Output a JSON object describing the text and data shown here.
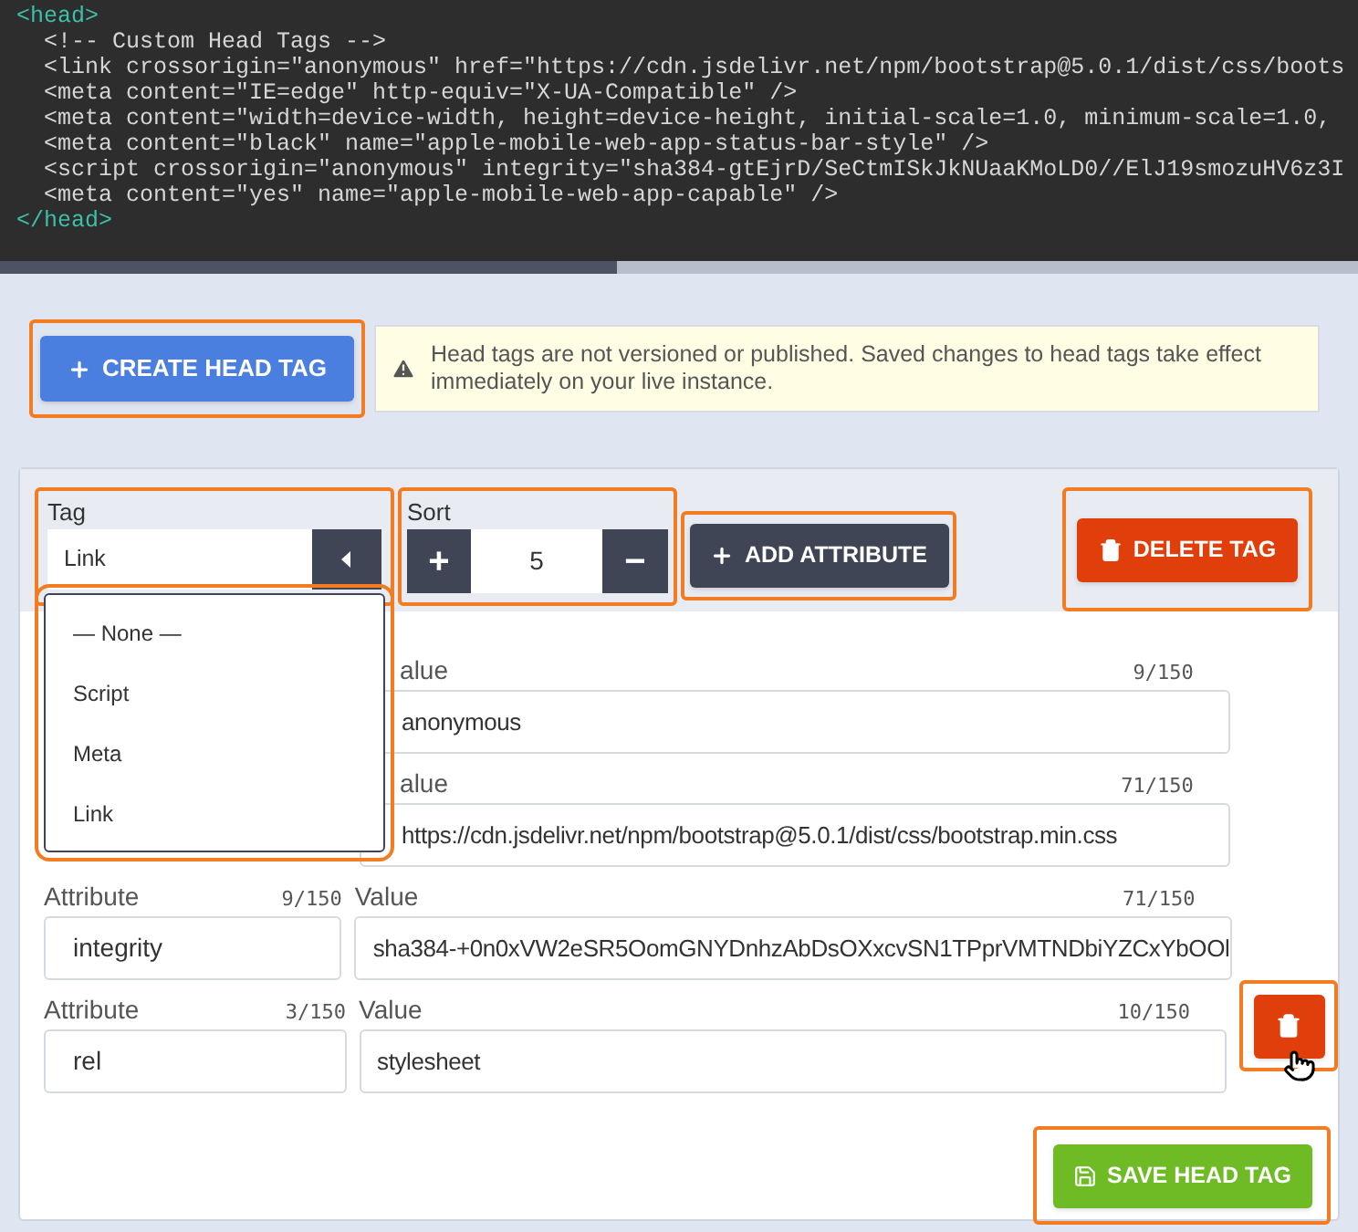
{
  "code_lines": [
    {
      "kind": "tag",
      "text": "<head>"
    },
    {
      "kind": "code",
      "text": "  <!-- Custom Head Tags -->"
    },
    {
      "kind": "code",
      "text": "  <link crossorigin=\"anonymous\" href=\"https://cdn.jsdelivr.net/npm/bootstrap@5.0.1/dist/css/boots"
    },
    {
      "kind": "code",
      "text": "  <meta content=\"IE=edge\" http-equiv=\"X-UA-Compatible\" />"
    },
    {
      "kind": "code",
      "text": "  <meta content=\"width=device-width, height=device-height, initial-scale=1.0, minimum-scale=1.0,"
    },
    {
      "kind": "code",
      "text": "  <meta content=\"black\" name=\"apple-mobile-web-app-status-bar-style\" />"
    },
    {
      "kind": "code",
      "text": "  <script crossorigin=\"anonymous\" integrity=\"sha384-gtEjrD/SeCtmISkJkNUaaKMoLD0//ElJ19smozuHV6z3I"
    },
    {
      "kind": "code",
      "text": "  <meta content=\"yes\" name=\"apple-mobile-web-app-capable\" />"
    },
    {
      "kind": "tag",
      "text": "</head>"
    }
  ],
  "create_button": "CREATE HEAD TAG",
  "notice": "Head tags are not versioned or published. Saved changes to head tags take effect immediately on your live instance.",
  "tag_field": {
    "label": "Tag",
    "value": "Link",
    "expanded": true,
    "options": [
      "— None —",
      "Script",
      "Meta",
      "Link"
    ]
  },
  "sort_field": {
    "label": "Sort",
    "value": "5",
    "increment": "+",
    "decrement": "−"
  },
  "add_attribute_button": "ADD ATTRIBUTE",
  "delete_tag_button": "DELETE TAG",
  "attributes": [
    {
      "kind": "covered",
      "value_label": "alue",
      "value_count": "9/150",
      "value": "anonymous"
    },
    {
      "kind": "covered",
      "value_label": "alue",
      "value_count": "71/150",
      "value": "https://cdn.jsdelivr.net/npm/bootstrap@5.0.1/dist/css/bootstrap.min.css"
    },
    {
      "kind": "full",
      "attribute_label": "Attribute",
      "attribute_count": "9/150",
      "attribute": "integrity",
      "value_label": "Value",
      "value_count": "71/150",
      "value": "sha384-+0n0xVW2eSR5OomGNYDnhzAbDsOXxcvSN1TPprVMTNDbiYZCxYbOOl"
    },
    {
      "kind": "full",
      "attribute_label": "Attribute",
      "attribute_count": "3/150",
      "attribute": "rel",
      "value_label": "Value",
      "value_count": "10/150",
      "value": "stylesheet",
      "delete_button": true
    }
  ],
  "save_button": "SAVE HEAD TAG"
}
